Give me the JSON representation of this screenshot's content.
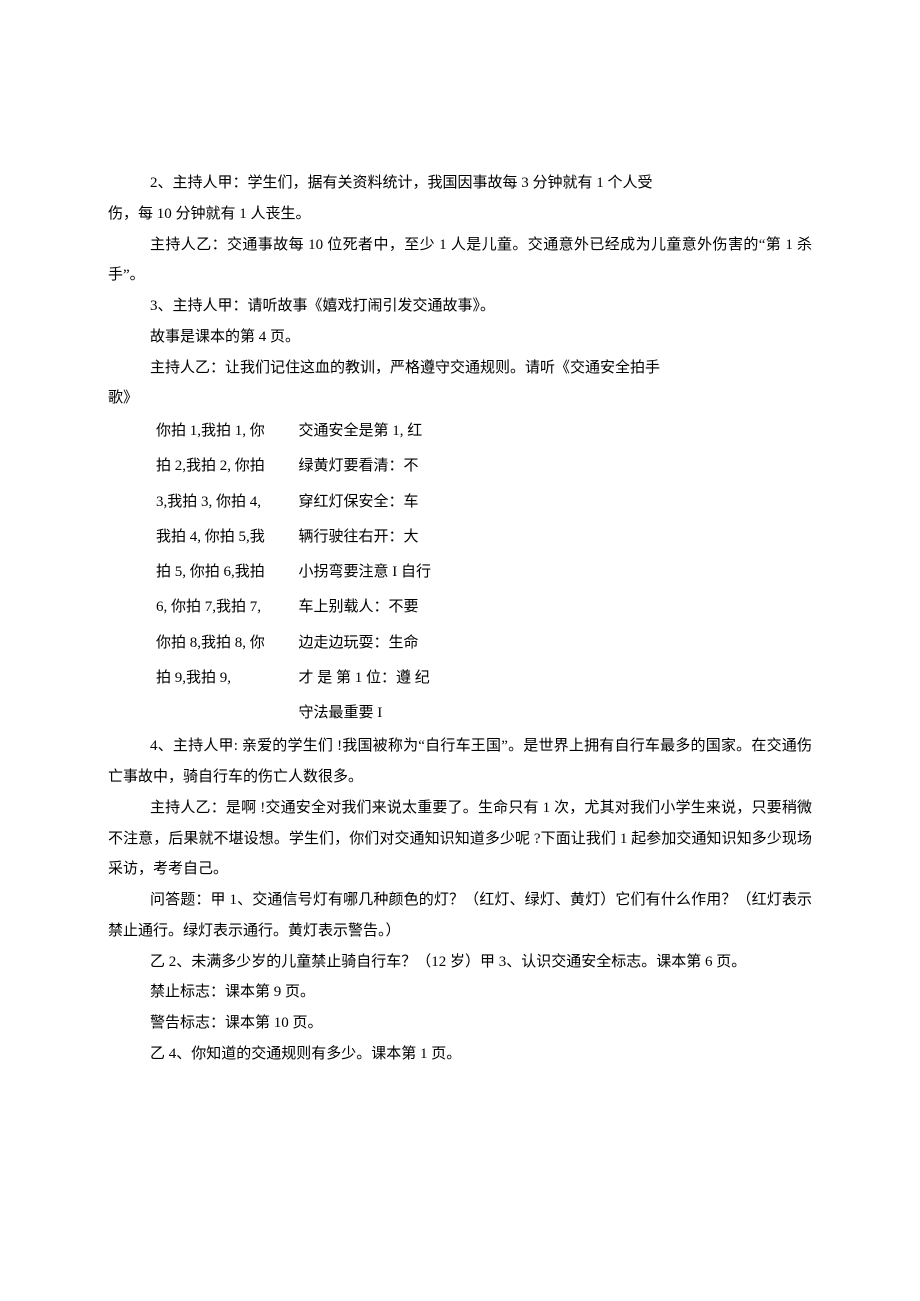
{
  "p1": "2、主持人甲：学生们，据有关资料统计，我国因事故每 3 分钟就有 1 个人受",
  "p2": "伤，每 10 分钟就有 1 人丧生。",
  "p3": "主持人乙：交通事故每 10 位死者中，至少 1 人是儿童。交通意外已经成为儿童意外伤害的“第 1 杀手”。",
  "p4": "3、主持人甲：请听故事《嬉戏打闹引发交通故事》。",
  "p5": "故事是课本的第 4 页。",
  "p6": "主持人乙：让我们记住这血的教训，严格遵守交通规则。请听《交通安全拍手",
  "p7": "歌》",
  "v1l": "你拍 1,我拍 1, 你",
  "v1r": "交通安全是第 1, 红",
  "v2l": "拍 2,我拍 2, 你拍",
  "v2r": "绿黄灯要看清：不",
  "v3l": "3,我拍 3, 你拍 4,",
  "v3r": "穿红灯保安全：车",
  "v4l": "我拍 4, 你拍 5,我",
  "v4r": "辆行驶往右开：大",
  "v5l": "拍 5, 你拍 6,我拍",
  "v5r": "小拐弯要注意 I 自行",
  "v6l": "6, 你拍 7,我拍 7,",
  "v6r": "车上别载人：不要",
  "v7l": "你拍 8,我拍 8, 你",
  "v7r": "边走边玩耍：生命",
  "v8l": "拍 9,我拍 9,",
  "v8r": "才 是 第 1 位：遵 纪",
  "v9": "守法最重要 I",
  "p8": "4、主持人甲: 亲爱的学生们 !我国被称为“自行车王国”。是世界上拥有自行车最多的国家。在交通伤亡事故中，骑自行车的伤亡人数很多。",
  "p9": "主持人乙：是啊 !交通安全对我们来说太重要了。生命只有 1 次，尤其对我们小学生来说，只要稍微不注意，后果就不堪设想。学生们，你们对交通知识知道多少呢 ?下面让我们 1 起参加交通知识知多少现场采访，考考自己。",
  "p10": "问答题：甲 1、交通信号灯有哪几种颜色的灯？（红灯、绿灯、黄灯）它们有什么作用？（红灯表示禁止通行。绿灯表示通行。黄灯表示警告。）",
  "p11": "乙 2、未满多少岁的儿童禁止骑自行车？（12 岁）甲 3、认识交通安全标志。课本第 6 页。",
  "p12": "禁止标志：课本第 9 页。",
  "p13": "警告标志：课本第 10 页。",
  "p14": "乙 4、你知道的交通规则有多少。课本第 1 页。"
}
